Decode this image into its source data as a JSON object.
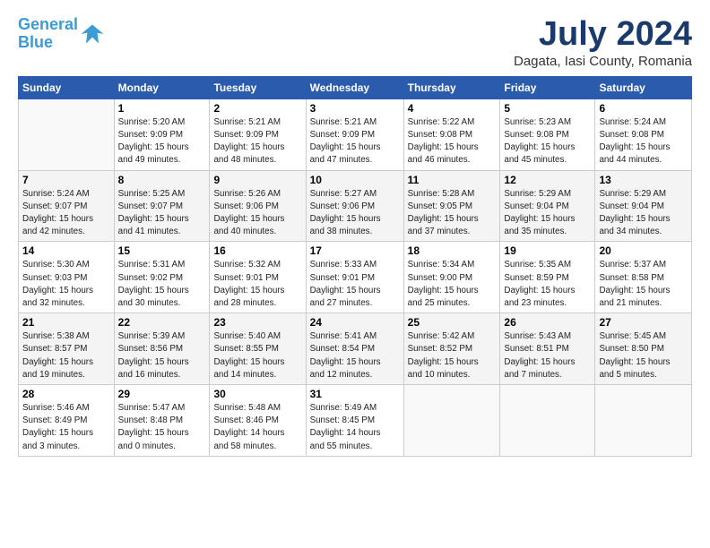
{
  "logo": {
    "line1": "General",
    "line2": "Blue"
  },
  "title": "July 2024",
  "location": "Dagata, Iasi County, Romania",
  "weekdays": [
    "Sunday",
    "Monday",
    "Tuesday",
    "Wednesday",
    "Thursday",
    "Friday",
    "Saturday"
  ],
  "weeks": [
    [
      {
        "day": "",
        "text": ""
      },
      {
        "day": "1",
        "text": "Sunrise: 5:20 AM\nSunset: 9:09 PM\nDaylight: 15 hours\nand 49 minutes."
      },
      {
        "day": "2",
        "text": "Sunrise: 5:21 AM\nSunset: 9:09 PM\nDaylight: 15 hours\nand 48 minutes."
      },
      {
        "day": "3",
        "text": "Sunrise: 5:21 AM\nSunset: 9:09 PM\nDaylight: 15 hours\nand 47 minutes."
      },
      {
        "day": "4",
        "text": "Sunrise: 5:22 AM\nSunset: 9:08 PM\nDaylight: 15 hours\nand 46 minutes."
      },
      {
        "day": "5",
        "text": "Sunrise: 5:23 AM\nSunset: 9:08 PM\nDaylight: 15 hours\nand 45 minutes."
      },
      {
        "day": "6",
        "text": "Sunrise: 5:24 AM\nSunset: 9:08 PM\nDaylight: 15 hours\nand 44 minutes."
      }
    ],
    [
      {
        "day": "7",
        "text": "Sunrise: 5:24 AM\nSunset: 9:07 PM\nDaylight: 15 hours\nand 42 minutes."
      },
      {
        "day": "8",
        "text": "Sunrise: 5:25 AM\nSunset: 9:07 PM\nDaylight: 15 hours\nand 41 minutes."
      },
      {
        "day": "9",
        "text": "Sunrise: 5:26 AM\nSunset: 9:06 PM\nDaylight: 15 hours\nand 40 minutes."
      },
      {
        "day": "10",
        "text": "Sunrise: 5:27 AM\nSunset: 9:06 PM\nDaylight: 15 hours\nand 38 minutes."
      },
      {
        "day": "11",
        "text": "Sunrise: 5:28 AM\nSunset: 9:05 PM\nDaylight: 15 hours\nand 37 minutes."
      },
      {
        "day": "12",
        "text": "Sunrise: 5:29 AM\nSunset: 9:04 PM\nDaylight: 15 hours\nand 35 minutes."
      },
      {
        "day": "13",
        "text": "Sunrise: 5:29 AM\nSunset: 9:04 PM\nDaylight: 15 hours\nand 34 minutes."
      }
    ],
    [
      {
        "day": "14",
        "text": "Sunrise: 5:30 AM\nSunset: 9:03 PM\nDaylight: 15 hours\nand 32 minutes."
      },
      {
        "day": "15",
        "text": "Sunrise: 5:31 AM\nSunset: 9:02 PM\nDaylight: 15 hours\nand 30 minutes."
      },
      {
        "day": "16",
        "text": "Sunrise: 5:32 AM\nSunset: 9:01 PM\nDaylight: 15 hours\nand 28 minutes."
      },
      {
        "day": "17",
        "text": "Sunrise: 5:33 AM\nSunset: 9:01 PM\nDaylight: 15 hours\nand 27 minutes."
      },
      {
        "day": "18",
        "text": "Sunrise: 5:34 AM\nSunset: 9:00 PM\nDaylight: 15 hours\nand 25 minutes."
      },
      {
        "day": "19",
        "text": "Sunrise: 5:35 AM\nSunset: 8:59 PM\nDaylight: 15 hours\nand 23 minutes."
      },
      {
        "day": "20",
        "text": "Sunrise: 5:37 AM\nSunset: 8:58 PM\nDaylight: 15 hours\nand 21 minutes."
      }
    ],
    [
      {
        "day": "21",
        "text": "Sunrise: 5:38 AM\nSunset: 8:57 PM\nDaylight: 15 hours\nand 19 minutes."
      },
      {
        "day": "22",
        "text": "Sunrise: 5:39 AM\nSunset: 8:56 PM\nDaylight: 15 hours\nand 16 minutes."
      },
      {
        "day": "23",
        "text": "Sunrise: 5:40 AM\nSunset: 8:55 PM\nDaylight: 15 hours\nand 14 minutes."
      },
      {
        "day": "24",
        "text": "Sunrise: 5:41 AM\nSunset: 8:54 PM\nDaylight: 15 hours\nand 12 minutes."
      },
      {
        "day": "25",
        "text": "Sunrise: 5:42 AM\nSunset: 8:52 PM\nDaylight: 15 hours\nand 10 minutes."
      },
      {
        "day": "26",
        "text": "Sunrise: 5:43 AM\nSunset: 8:51 PM\nDaylight: 15 hours\nand 7 minutes."
      },
      {
        "day": "27",
        "text": "Sunrise: 5:45 AM\nSunset: 8:50 PM\nDaylight: 15 hours\nand 5 minutes."
      }
    ],
    [
      {
        "day": "28",
        "text": "Sunrise: 5:46 AM\nSunset: 8:49 PM\nDaylight: 15 hours\nand 3 minutes."
      },
      {
        "day": "29",
        "text": "Sunrise: 5:47 AM\nSunset: 8:48 PM\nDaylight: 15 hours\nand 0 minutes."
      },
      {
        "day": "30",
        "text": "Sunrise: 5:48 AM\nSunset: 8:46 PM\nDaylight: 14 hours\nand 58 minutes."
      },
      {
        "day": "31",
        "text": "Sunrise: 5:49 AM\nSunset: 8:45 PM\nDaylight: 14 hours\nand 55 minutes."
      },
      {
        "day": "",
        "text": ""
      },
      {
        "day": "",
        "text": ""
      },
      {
        "day": "",
        "text": ""
      }
    ]
  ]
}
